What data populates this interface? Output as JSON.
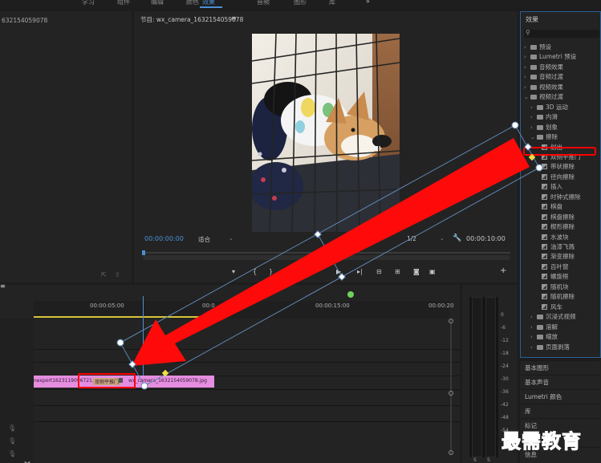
{
  "menu": {
    "items": [
      "学习",
      "组件",
      "编辑",
      "颜色",
      "效果",
      "音频",
      "图形",
      "库"
    ],
    "active_index": 4,
    "overflow": "»"
  },
  "source_panel": {
    "title_fragment": "632154059078"
  },
  "program": {
    "title": "节目: wx_camera_1632154059078",
    "menu_glyph": "≡",
    "timecode_left": "00:00:00:00",
    "fit_label": "适合",
    "zoom_label": "1/2",
    "timecode_right": "00:00:10:00"
  },
  "effects": {
    "title": "效果",
    "search_placeholder": "",
    "items": [
      {
        "label": "预设",
        "kind": "folder",
        "depth": 0
      },
      {
        "label": "Lumetri 预设",
        "kind": "folder",
        "depth": 0
      },
      {
        "label": "音频效果",
        "kind": "folder",
        "depth": 0
      },
      {
        "label": "音频过渡",
        "kind": "folder",
        "depth": 0
      },
      {
        "label": "视频效果",
        "kind": "folder",
        "depth": 0
      },
      {
        "label": "视频过渡",
        "kind": "folder",
        "depth": 0,
        "open": true
      },
      {
        "label": "3D 运动",
        "kind": "folder",
        "depth": 1
      },
      {
        "label": "内滑",
        "kind": "folder",
        "depth": 1
      },
      {
        "label": "划象",
        "kind": "folder",
        "depth": 1
      },
      {
        "label": "擦除",
        "kind": "folder",
        "depth": 1,
        "open": true
      },
      {
        "label": "划出",
        "kind": "fx",
        "depth": 2
      },
      {
        "label": "双侧平推门",
        "kind": "fx",
        "depth": 2,
        "highlighted": true
      },
      {
        "label": "带状擦除",
        "kind": "fx",
        "depth": 2
      },
      {
        "label": "径向擦除",
        "kind": "fx",
        "depth": 2
      },
      {
        "label": "插入",
        "kind": "fx",
        "depth": 2
      },
      {
        "label": "时钟式擦除",
        "kind": "fx",
        "depth": 2
      },
      {
        "label": "棋盘",
        "kind": "fx",
        "depth": 2
      },
      {
        "label": "棋盘擦除",
        "kind": "fx",
        "depth": 2
      },
      {
        "label": "楔形擦除",
        "kind": "fx",
        "depth": 2
      },
      {
        "label": "水波块",
        "kind": "fx",
        "depth": 2
      },
      {
        "label": "油漆飞溅",
        "kind": "fx",
        "depth": 2
      },
      {
        "label": "渐变擦除",
        "kind": "fx",
        "depth": 2
      },
      {
        "label": "百叶窗",
        "kind": "fx",
        "depth": 2
      },
      {
        "label": "螺旋框",
        "kind": "fx",
        "depth": 2
      },
      {
        "label": "随机块",
        "kind": "fx",
        "depth": 2
      },
      {
        "label": "随机擦除",
        "kind": "fx",
        "depth": 2
      },
      {
        "label": "风车",
        "kind": "fx",
        "depth": 2
      },
      {
        "label": "沉浸式视频",
        "kind": "folder",
        "depth": 1
      },
      {
        "label": "溶解",
        "kind": "folder",
        "depth": 1
      },
      {
        "label": "缩放",
        "kind": "folder",
        "depth": 1
      },
      {
        "label": "页面剥落",
        "kind": "folder",
        "depth": 1
      }
    ],
    "sections": [
      "基本图形",
      "基本声音",
      "Lumetri 颜色",
      "库",
      "标记",
      "信息"
    ]
  },
  "timeline": {
    "ruler": [
      "00:00:05:00",
      "00:0",
      "00:00:15:00",
      "00:00:20"
    ],
    "clip_a": "nexport1623119096721.jpg",
    "transition_label": "双侧平推门",
    "clip_b": "wx_camera_1632154059078.jpg"
  },
  "meter": {
    "ticks": [
      "0",
      "-6",
      "-12",
      "-18",
      "-24",
      "-30",
      "-36",
      "-42",
      "-48",
      "-54"
    ],
    "footer": [
      "S",
      "S"
    ]
  },
  "watermark": "最需教育",
  "colors": {
    "accent": "#4c8fd6",
    "highlight_box": "#ff0000",
    "arrow": "#ff0a0a",
    "clip": "#e58ee0",
    "playhead": "#4c8fd6"
  }
}
